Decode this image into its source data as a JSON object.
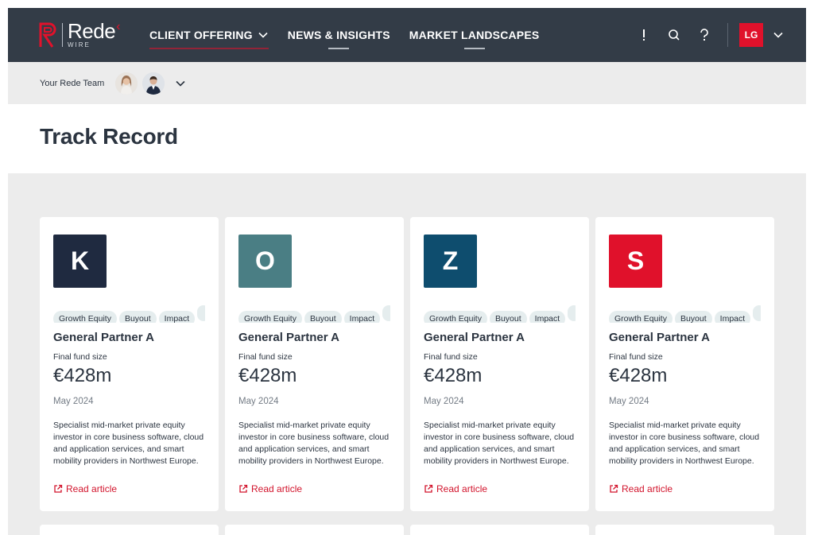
{
  "nav": {
    "logo": {
      "brand": "Rede",
      "sub": "WIRE"
    },
    "items": [
      {
        "label": "CLIENT OFFERING",
        "has_dropdown": true
      },
      {
        "label": "NEWS & INSIGHTS",
        "has_dropdown": false
      },
      {
        "label": "MARKET LANDSCAPES",
        "has_dropdown": false
      }
    ],
    "icons": [
      "alert-icon",
      "search-icon",
      "help-icon"
    ],
    "user_initials": "LG",
    "colors": {
      "bar": "#333c47",
      "accent": "#e0112b"
    }
  },
  "team": {
    "label": "Your Rede Team"
  },
  "page": {
    "title": "Track Record"
  },
  "cards": [
    {
      "letter": "K",
      "tile_color": "#1f2a40",
      "tags": [
        "Growth Equity",
        "Buyout",
        "Impact",
        ""
      ],
      "title": "General Partner A",
      "fund_label": "Final fund size",
      "fund_value": "€428m",
      "date": "May 2024",
      "description": "Specialist mid-market private equity investor in core business software, cloud and application services, and smart mobility providers in Northwest Europe.",
      "link": "Read article"
    },
    {
      "letter": "O",
      "tile_color": "#4a7e84",
      "tags": [
        "Growth Equity",
        "Buyout",
        "Impact",
        ""
      ],
      "title": "General Partner A",
      "fund_label": "Final fund size",
      "fund_value": "€428m",
      "date": "May 2024",
      "description": "Specialist mid-market private equity investor in core business software, cloud and application services, and smart mobility providers in Northwest Europe.",
      "link": "Read article"
    },
    {
      "letter": "Z",
      "tile_color": "#0e4d6e",
      "tags": [
        "Growth Equity",
        "Buyout",
        "Impact",
        ""
      ],
      "title": "General Partner A",
      "fund_label": "Final fund size",
      "fund_value": "€428m",
      "date": "May 2024",
      "description": "Specialist mid-market private equity investor in core business software, cloud and application services, and smart mobility providers in Northwest Europe.",
      "link": "Read article"
    },
    {
      "letter": "S",
      "tile_color": "#e0112b",
      "tags": [
        "Growth Equity",
        "Buyout",
        "Impact",
        ""
      ],
      "title": "General Partner A",
      "fund_label": "Final fund size",
      "fund_value": "€428m",
      "date": "May 2024",
      "description": "Specialist mid-market private equity investor in core business software, cloud and application services, and smart mobility providers in Northwest Europe.",
      "link": "Read article"
    }
  ]
}
